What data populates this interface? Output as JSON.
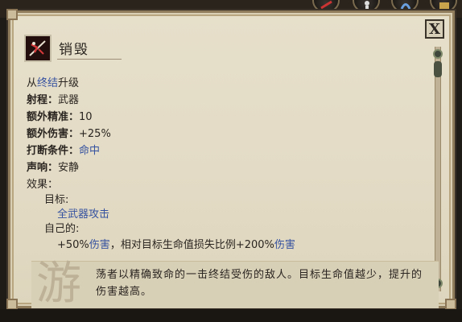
{
  "tooltip": {
    "title": "销毁",
    "close_label": "X",
    "icon": "ability-slash-icon",
    "upgrade": {
      "prefix": "从",
      "link": "终结",
      "suffix": "升级"
    },
    "stats": [
      {
        "label": "射程：",
        "value": "武器",
        "value_style": "plain"
      },
      {
        "label": "额外精准：",
        "value": "10",
        "value_style": "plain"
      },
      {
        "label": "额外伤害：",
        "value": "+25%",
        "value_style": "plain"
      },
      {
        "label": "打断条件：",
        "value": "命中",
        "value_style": "blue"
      },
      {
        "label": "声响：",
        "value": "安静",
        "value_style": "plain"
      }
    ],
    "effects_label": "效果：",
    "target_label": "目标:",
    "target_value": "全武器攻击",
    "self_label": "自己的:",
    "self_effect": {
      "part1": "+50%",
      "part2": "伤害",
      "part3": "，相对目标生命值损失比例+200%",
      "part4": "伤害"
    },
    "description": "荡者以精确致命的一击终结受伤的敌人。目标生命值越少，提升的伤害越高。",
    "watermark": "游"
  },
  "colors": {
    "parchment": "#e6dfca",
    "link_blue": "#3552a0",
    "text": "#2a2520"
  }
}
